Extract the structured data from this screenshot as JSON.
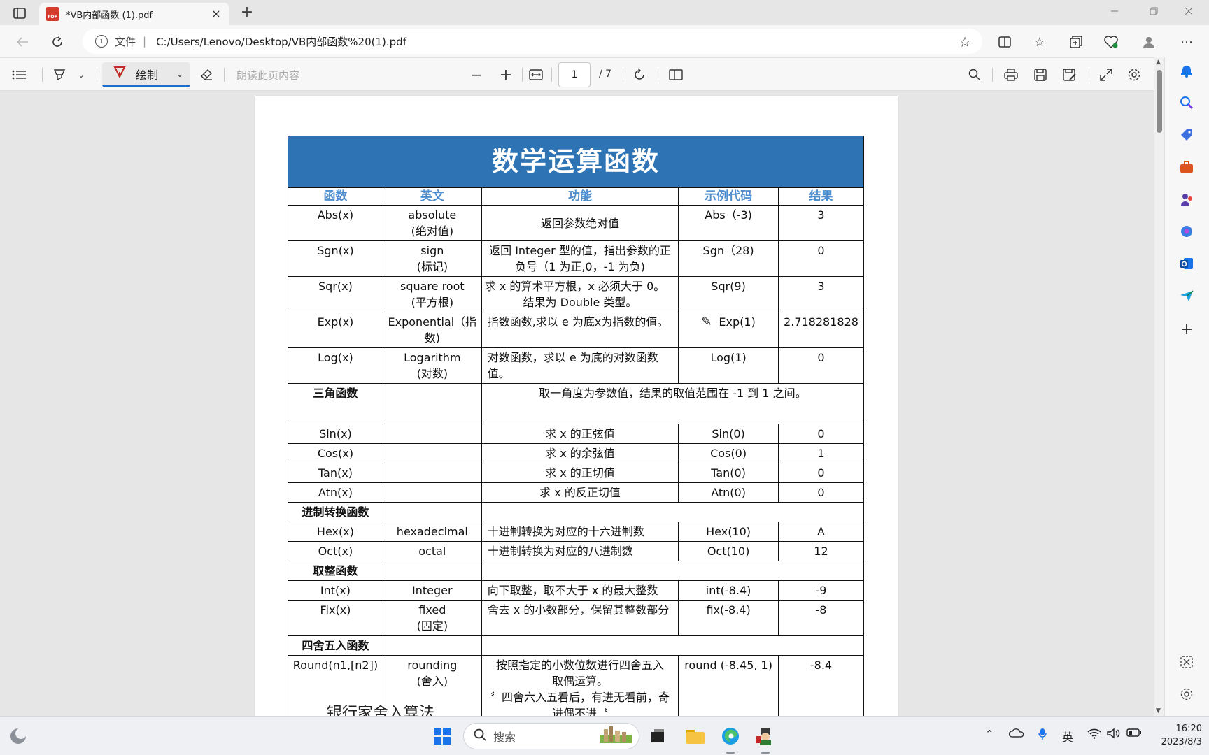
{
  "browser": {
    "tab_title": "*VB内部函数 (1).pdf",
    "pdf_badge": "PDF",
    "new_tab": "+",
    "close": "×",
    "scheme_label": "文件",
    "separator": "|",
    "url": "C:/Users/Lenovo/Desktop/VB内部函数%20(1).pdf"
  },
  "pdf_toolbar": {
    "draw_label": "绘制",
    "read_aloud": "朗读此页内容",
    "page_current": "1",
    "page_total": "/ 7"
  },
  "table": {
    "banner": "数学运算函数",
    "headers": [
      "函数",
      "英文",
      "功能",
      "示例代码",
      "结果"
    ],
    "rows": {
      "abs": [
        "Abs(x)",
        "absolute",
        "(绝对值)",
        "返回参数绝对值",
        "Abs（-3)",
        "3"
      ],
      "sgn": [
        "Sgn(x)",
        "sign",
        "(标记)",
        "返回 Integer 型的值，指出参数的正",
        "负号（1 为正,0，-1 为负)",
        "Sgn（28)",
        "0"
      ],
      "sqr": [
        "Sqr(x)",
        "square root",
        "(平方根)",
        "求 x 的算术平方根，x 必须大于 0。",
        "结果为 Double 类型。",
        "Sqr(9)",
        "3"
      ],
      "exp": [
        "Exp(x)",
        "Exponential（指",
        "数)",
        "指数函数,求以 e 为底x为指数的值。",
        "Exp(1)",
        "2.718281828"
      ],
      "log": [
        "Log(x)",
        "Logarithm",
        "(对数)",
        "对数函数，求以 e 为底的对数函数",
        "值。",
        "Log(1)",
        "0"
      ],
      "trig_title": [
        "三角函数",
        "取一角度为参数值，结果的取值范围在 -1 到 1 之间。"
      ],
      "sin": [
        "Sin(x)",
        "求 x 的正弦值",
        "Sin(0)",
        "0"
      ],
      "cos": [
        "Cos(x)",
        "求 x 的余弦值",
        "Cos(0)",
        "1"
      ],
      "tan": [
        "Tan(x)",
        "求 x 的正切值",
        "Tan(0)",
        "0"
      ],
      "atn": [
        "Atn(x)",
        "求 x 的反正切值",
        "Atn(0)",
        "0"
      ],
      "base_title": [
        "进制转换函数"
      ],
      "hex": [
        "Hex(x)",
        "hexadecimal",
        "十进制转换为对应的十六进制数",
        "Hex(10)",
        "A"
      ],
      "oct": [
        "Oct(x)",
        "octal",
        "十进制转换为对应的八进制数",
        "Oct(10)",
        "12"
      ],
      "int_title": [
        "取整函数"
      ],
      "int": [
        "Int(x)",
        "Integer",
        "向下取整，取不大于 x 的最大整数",
        "int(-8.4)",
        "-9"
      ],
      "fix": [
        "Fix(x)",
        "fixed",
        "(固定)",
        "舍去 x 的小数部分，保留其整数部分",
        "fix(-8.4)",
        "-8"
      ],
      "round_title": [
        "四舍五入函数"
      ],
      "round": [
        "Round(n1,[n2])",
        "rounding",
        "(舍入)",
        "按照指定的小数位数进行四舍五入",
        "取偶运算。",
        "〞四舍六入五看后，有进无看前，奇",
        "进偶不进〝",
        "round (-8.45, 1)",
        "-8.4"
      ]
    }
  },
  "below_table_heading": "银行家舍入算法",
  "taskbar": {
    "search_placeholder": "搜索",
    "ime": "英",
    "time": "16:20",
    "date": "2023/8/3"
  }
}
